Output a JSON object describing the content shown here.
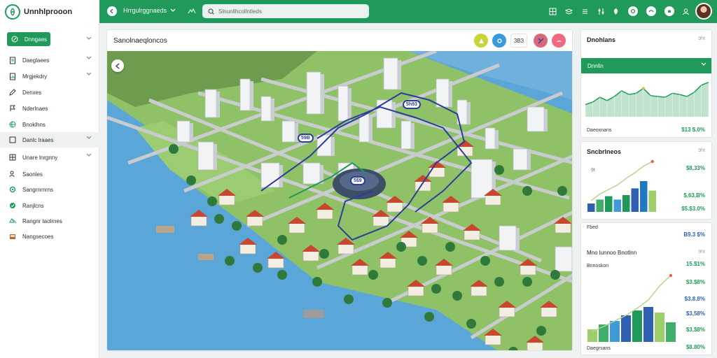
{
  "app": {
    "name": "Unnhlprooon"
  },
  "header": {
    "project": "Hrrgulrggnaeds",
    "search_text": "Slnunllhcollntleds",
    "icons": [
      "back-icon",
      "chevron-down-icon",
      "wave-icon",
      "search-icon",
      "grid-icon",
      "layers-icon",
      "list-icon",
      "sliders-icon",
      "map-pin-icon",
      "chat-icon",
      "globe-icon",
      "bell-icon",
      "avatar"
    ]
  },
  "sidebar": {
    "items": [
      {
        "label": "Dnngaes",
        "icon": "leaf-icon",
        "chevron": true
      },
      {
        "label": "Daeglaees",
        "icon": "document-icon",
        "chevron": true
      },
      {
        "label": "Mrgjekdry",
        "icon": "report-icon",
        "chevron": true
      },
      {
        "label": "Denxes",
        "icon": "pen-icon",
        "chevron": false
      },
      {
        "label": "Nderlnaes",
        "icon": "flag-icon",
        "chevron": false
      },
      {
        "label": "Bnoklhns",
        "icon": "globe-icon",
        "chevron": false
      },
      {
        "label": "Danlc lraaes",
        "icon": "square-icon",
        "chevron": true
      },
      {
        "label": "Unare lnrgnny",
        "icon": "grid-icon",
        "chevron": true
      },
      {
        "label": "Saonles",
        "icon": "people-icon",
        "chevron": false
      },
      {
        "label": "Sangrnrnrns",
        "icon": "settings-icon",
        "chevron": false
      },
      {
        "label": "Ranjlcns",
        "icon": "shield-icon",
        "chevron": false
      },
      {
        "label": "Rangnr taolrnes",
        "icon": "recycle-icon",
        "chevron": false
      },
      {
        "label": "Nangsecoes",
        "icon": "box-icon",
        "chevron": false
      }
    ]
  },
  "map_card": {
    "title": "Sanolnaeqloncos",
    "tool_count": "3B3",
    "badges": [
      "59B",
      "5h93",
      "5$9"
    ],
    "colors": {
      "water": "#5aa6d8",
      "grass": "#8fc266",
      "road": "#c9ccce",
      "route": "#2c3e9c",
      "accent": "#1f9a5a"
    }
  },
  "panels": {
    "p1": {
      "title": "Dnohlans",
      "x_label": "9ht",
      "dropdown": "Dnnlln",
      "footer_label": "Daeoxnans",
      "footer_value": "$13 $.0%",
      "chart_data": {
        "type": "area",
        "values": [
          30,
          36,
          48,
          40,
          50,
          64,
          55,
          58,
          70,
          52,
          50,
          48,
          58,
          55,
          50,
          60,
          78,
          85
        ]
      }
    },
    "p2": {
      "title": "Sncbrlneos",
      "x_label": "9ht",
      "tick": "9t",
      "footer_tick": "rSt",
      "values": [
        "$8,33%",
        "$,63,B%",
        "$5.$3.0%"
      ],
      "chart_data": {
        "type": "bar",
        "values": [
          15,
          22,
          28,
          22,
          30,
          42,
          55,
          38
        ],
        "line": [
          20,
          32,
          40,
          48,
          60,
          70,
          82,
          90
        ]
      }
    },
    "p3": {
      "header_label": "Fbed",
      "header_value": "B9.3 $%",
      "title": "Mno lunnoo Bnotlnn",
      "x_label": "9ht",
      "rows": [
        {
          "label": "Bnnoskon",
          "value": "15.$1%",
          "color": "#1f9a5a"
        },
        {
          "label": "",
          "value": "$3.$8%",
          "color": "#1f9a5a"
        },
        {
          "label": "",
          "value": "$3.8.8%",
          "color": "#2f5fb0"
        },
        {
          "label": "",
          "value": "$3,58%",
          "color": "#2f5fb0"
        },
        {
          "label": "",
          "value": "$3,$8%",
          "color": "#1f9a5a"
        },
        {
          "label": "Daegrsans",
          "value": "$8.80%",
          "color": "#1f9a5a"
        }
      ],
      "chart_data": {
        "type": "bar",
        "values": [
          18,
          25,
          30,
          38,
          45,
          50,
          42,
          28
        ],
        "line": [
          15,
          22,
          30,
          38,
          48,
          60,
          80,
          95
        ]
      }
    }
  }
}
